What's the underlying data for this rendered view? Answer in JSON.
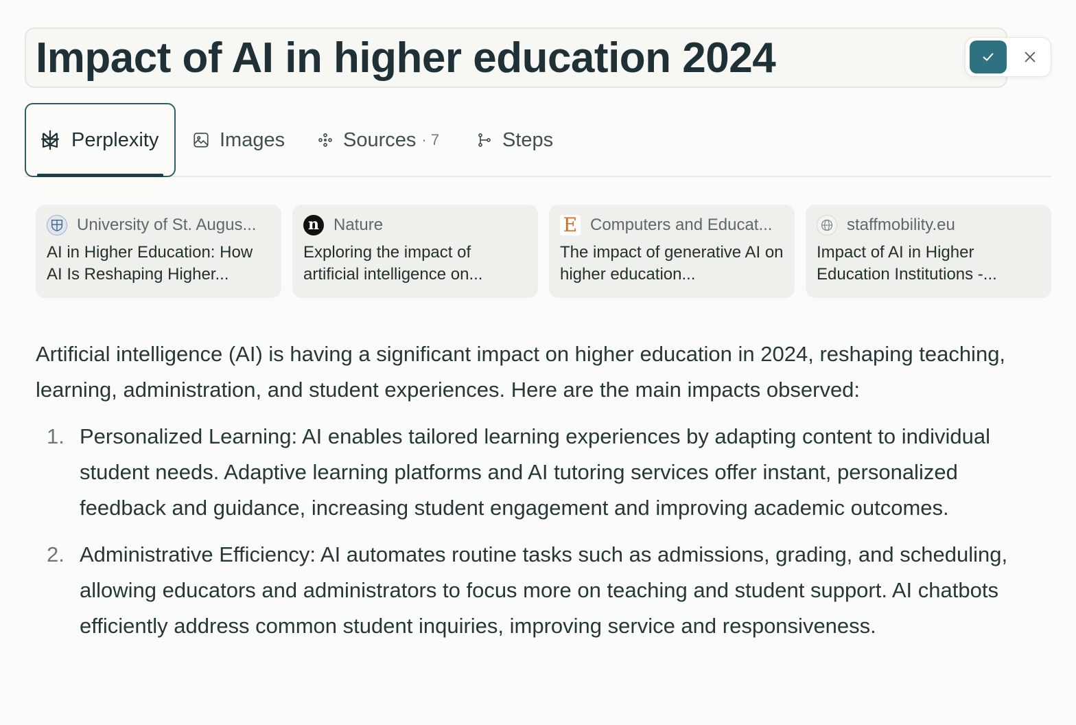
{
  "title_field": {
    "value": "Impact of AI in higher education 2024"
  },
  "tabs": [
    {
      "label": "Perplexity",
      "icon": "perplexity-logo-icon",
      "active": true
    },
    {
      "label": "Images",
      "icon": "image-icon"
    },
    {
      "label": "Sources",
      "icon": "sources-icon",
      "count": "· 7"
    },
    {
      "label": "Steps",
      "icon": "steps-icon"
    }
  ],
  "sources": [
    {
      "site": "University of St. Augus...",
      "title": "AI in Higher Education: How AI Is Reshaping Higher...",
      "icon": "university-crest-icon"
    },
    {
      "site": "Nature",
      "title": "Exploring the impact of artificial intelligence on...",
      "icon": "nature-logo-icon"
    },
    {
      "site": "Computers and Educat...",
      "title": "The impact of generative AI on higher education...",
      "icon": "elsevier-logo-icon"
    },
    {
      "site": "staffmobility.eu",
      "title": "Impact of AI in Higher Education Institutions -...",
      "icon": "globe-icon"
    }
  ],
  "answer": {
    "intro": "Artificial intelligence (AI) is having a significant impact on higher education in 2024, reshaping teaching, learning, administration, and student experiences. Here are the main impacts observed:",
    "items": [
      {
        "num": "1.",
        "text": "Personalized Learning: AI enables tailored learning experiences by adapting content to individual student needs. Adaptive learning platforms and AI tutoring services offer instant, personalized feedback and guidance, increasing student engagement and improving academic outcomes."
      },
      {
        "num": "2.",
        "text": "Administrative Efficiency: AI automates routine tasks such as admissions, grading, and scheduling, allowing educators and administrators to focus more on teaching and student support. AI chatbots efficiently address common student inquiries, improving service and responsiveness."
      }
    ]
  },
  "colors": {
    "accent": "#2e7181",
    "background": "#fbfbf9",
    "card": "#efefeb"
  }
}
